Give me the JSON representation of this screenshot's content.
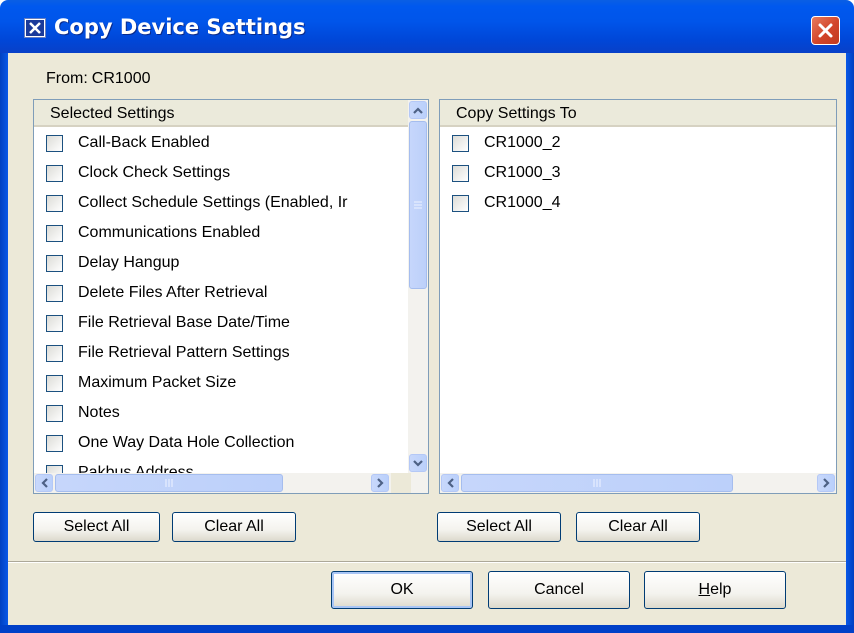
{
  "window": {
    "title": "Copy Device Settings",
    "close_icon": "close-icon",
    "app_icon": "settings-app-icon"
  },
  "from": {
    "label": "From:",
    "value": "CR1000"
  },
  "selected_settings": {
    "header": "Selected Settings",
    "items": [
      "Call-Back Enabled",
      "Clock Check Settings",
      "Collect Schedule Settings (Enabled, Ir",
      "Communications Enabled",
      "Delay Hangup",
      "Delete Files After Retrieval",
      "File Retrieval Base Date/Time",
      "File Retrieval Pattern Settings",
      "Maximum Packet Size",
      "Notes",
      "One Way Data Hole Collection",
      "Pakbus Address"
    ],
    "checked": [
      false,
      false,
      false,
      false,
      false,
      false,
      false,
      false,
      false,
      false,
      false,
      false
    ],
    "select_all_label": "Select All",
    "clear_all_label": "Clear All"
  },
  "copy_to": {
    "header": "Copy Settings To",
    "items": [
      "CR1000_2",
      "CR1000_3",
      "CR1000_4"
    ],
    "checked": [
      false,
      false,
      false
    ],
    "select_all_label": "Select All",
    "clear_all_label": "Clear All"
  },
  "footer": {
    "ok_label": "OK",
    "cancel_label": "Cancel",
    "help_label": "Help",
    "help_mnemonic": "H",
    "help_rest": "elp"
  },
  "colors": {
    "title_bar": "#0055ea",
    "dialog_bg": "#ece9d8",
    "close_button": "#d2452a",
    "scrollbar": "#c1d3fb"
  }
}
